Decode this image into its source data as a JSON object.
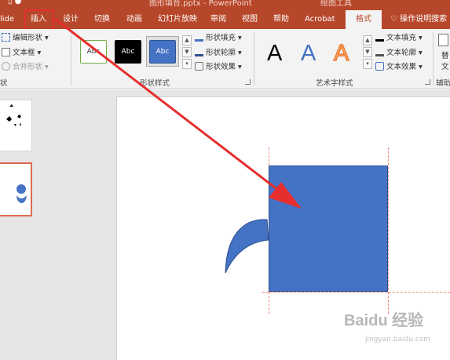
{
  "window": {
    "title": "图形填合.pptx - PowerPoint",
    "context_tab_group": "绘图工具"
  },
  "tabs": [
    {
      "label": "lide"
    },
    {
      "label": "插入"
    },
    {
      "label": "设计"
    },
    {
      "label": "切换"
    },
    {
      "label": "动画"
    },
    {
      "label": "幻灯片放映"
    },
    {
      "label": "审阅"
    },
    {
      "label": "视图"
    },
    {
      "label": "帮助"
    },
    {
      "label": "Acrobat"
    },
    {
      "label": "格式",
      "active": true
    }
  ],
  "tell_me": "操作说明搜索",
  "ribbon": {
    "insert_shapes": {
      "edit_shape": "编辑形状",
      "text_box": "文本框",
      "merge_shapes": "合并形状",
      "group_label": "状"
    },
    "shape_styles": {
      "previews": [
        "Abc",
        "Abc",
        "Abc"
      ],
      "fill": "形状填充",
      "outline": "形状轮廓",
      "effects": "形状效果",
      "group_label": "形状样式"
    },
    "wordart": {
      "previews": [
        "A",
        "A",
        "A"
      ],
      "text_fill": "文本填充",
      "text_outline": "文本轮廓",
      "text_effects": "文本效果",
      "group_label": "艺术字样式"
    },
    "accessibility": {
      "group_label": "辅助",
      "alt_text_1": "替",
      "alt_text_2": "文"
    }
  },
  "watermark": {
    "brand": "Baidu 经验",
    "url": "jingyan.baidu.com"
  },
  "colors": {
    "ribbon_accent": "#b7472a",
    "shape_fill": "#4472c4",
    "annotation_red": "#e62e2e",
    "guide": "#e8847a"
  }
}
